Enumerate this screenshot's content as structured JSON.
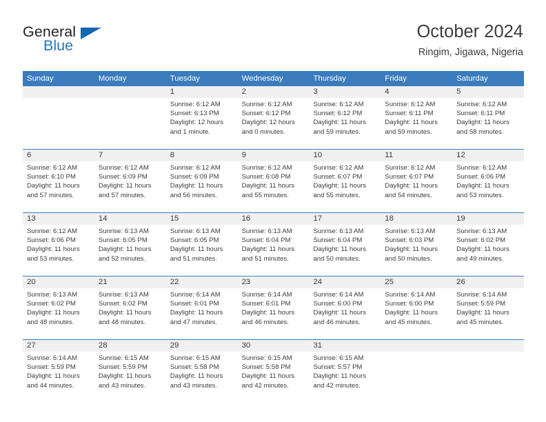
{
  "brand": {
    "line1": "General",
    "line2": "Blue",
    "triangle_icon": "brand-triangle-icon",
    "accent_color": "#1f77c4"
  },
  "header": {
    "title": "October 2024",
    "location": "Ringim, Jigawa, Nigeria"
  },
  "theme": {
    "header_blue": "#3a7cbd",
    "number_band_gray": "#f0f0f0",
    "text_color": "#3a3a3a"
  },
  "day_names": [
    "Sunday",
    "Monday",
    "Tuesday",
    "Wednesday",
    "Thursday",
    "Friday",
    "Saturday"
  ],
  "labels": {
    "sunrise_prefix": "Sunrise:",
    "sunset_prefix": "Sunset:",
    "daylight_prefix": "Daylight:"
  },
  "weeks": [
    [
      {
        "day": "",
        "empty": true
      },
      {
        "day": "",
        "empty": true
      },
      {
        "day": "1",
        "sunrise": "Sunrise: 6:12 AM",
        "sunset": "Sunset: 6:13 PM",
        "daylight_1": "Daylight: 12 hours",
        "daylight_2": "and 1 minute."
      },
      {
        "day": "2",
        "sunrise": "Sunrise: 6:12 AM",
        "sunset": "Sunset: 6:12 PM",
        "daylight_1": "Daylight: 12 hours",
        "daylight_2": "and 0 minutes."
      },
      {
        "day": "3",
        "sunrise": "Sunrise: 6:12 AM",
        "sunset": "Sunset: 6:12 PM",
        "daylight_1": "Daylight: 11 hours",
        "daylight_2": "and 59 minutes."
      },
      {
        "day": "4",
        "sunrise": "Sunrise: 6:12 AM",
        "sunset": "Sunset: 6:11 PM",
        "daylight_1": "Daylight: 11 hours",
        "daylight_2": "and 59 minutes."
      },
      {
        "day": "5",
        "sunrise": "Sunrise: 6:12 AM",
        "sunset": "Sunset: 6:11 PM",
        "daylight_1": "Daylight: 11 hours",
        "daylight_2": "and 58 minutes."
      }
    ],
    [
      {
        "day": "6",
        "sunrise": "Sunrise: 6:12 AM",
        "sunset": "Sunset: 6:10 PM",
        "daylight_1": "Daylight: 11 hours",
        "daylight_2": "and 57 minutes."
      },
      {
        "day": "7",
        "sunrise": "Sunrise: 6:12 AM",
        "sunset": "Sunset: 6:09 PM",
        "daylight_1": "Daylight: 11 hours",
        "daylight_2": "and 57 minutes."
      },
      {
        "day": "8",
        "sunrise": "Sunrise: 6:12 AM",
        "sunset": "Sunset: 6:09 PM",
        "daylight_1": "Daylight: 11 hours",
        "daylight_2": "and 56 minutes."
      },
      {
        "day": "9",
        "sunrise": "Sunrise: 6:12 AM",
        "sunset": "Sunset: 6:08 PM",
        "daylight_1": "Daylight: 11 hours",
        "daylight_2": "and 55 minutes."
      },
      {
        "day": "10",
        "sunrise": "Sunrise: 6:12 AM",
        "sunset": "Sunset: 6:07 PM",
        "daylight_1": "Daylight: 11 hours",
        "daylight_2": "and 55 minutes."
      },
      {
        "day": "11",
        "sunrise": "Sunrise: 6:12 AM",
        "sunset": "Sunset: 6:07 PM",
        "daylight_1": "Daylight: 11 hours",
        "daylight_2": "and 54 minutes."
      },
      {
        "day": "12",
        "sunrise": "Sunrise: 6:12 AM",
        "sunset": "Sunset: 6:06 PM",
        "daylight_1": "Daylight: 11 hours",
        "daylight_2": "and 53 minutes."
      }
    ],
    [
      {
        "day": "13",
        "sunrise": "Sunrise: 6:12 AM",
        "sunset": "Sunset: 6:06 PM",
        "daylight_1": "Daylight: 11 hours",
        "daylight_2": "and 53 minutes."
      },
      {
        "day": "14",
        "sunrise": "Sunrise: 6:13 AM",
        "sunset": "Sunset: 6:05 PM",
        "daylight_1": "Daylight: 11 hours",
        "daylight_2": "and 52 minutes."
      },
      {
        "day": "15",
        "sunrise": "Sunrise: 6:13 AM",
        "sunset": "Sunset: 6:05 PM",
        "daylight_1": "Daylight: 11 hours",
        "daylight_2": "and 51 minutes."
      },
      {
        "day": "16",
        "sunrise": "Sunrise: 6:13 AM",
        "sunset": "Sunset: 6:04 PM",
        "daylight_1": "Daylight: 11 hours",
        "daylight_2": "and 51 minutes."
      },
      {
        "day": "17",
        "sunrise": "Sunrise: 6:13 AM",
        "sunset": "Sunset: 6:04 PM",
        "daylight_1": "Daylight: 11 hours",
        "daylight_2": "and 50 minutes."
      },
      {
        "day": "18",
        "sunrise": "Sunrise: 6:13 AM",
        "sunset": "Sunset: 6:03 PM",
        "daylight_1": "Daylight: 11 hours",
        "daylight_2": "and 50 minutes."
      },
      {
        "day": "19",
        "sunrise": "Sunrise: 6:13 AM",
        "sunset": "Sunset: 6:02 PM",
        "daylight_1": "Daylight: 11 hours",
        "daylight_2": "and 49 minutes."
      }
    ],
    [
      {
        "day": "20",
        "sunrise": "Sunrise: 6:13 AM",
        "sunset": "Sunset: 6:02 PM",
        "daylight_1": "Daylight: 11 hours",
        "daylight_2": "and 48 minutes."
      },
      {
        "day": "21",
        "sunrise": "Sunrise: 6:13 AM",
        "sunset": "Sunset: 6:02 PM",
        "daylight_1": "Daylight: 11 hours",
        "daylight_2": "and 48 minutes."
      },
      {
        "day": "22",
        "sunrise": "Sunrise: 6:14 AM",
        "sunset": "Sunset: 6:01 PM",
        "daylight_1": "Daylight: 11 hours",
        "daylight_2": "and 47 minutes."
      },
      {
        "day": "23",
        "sunrise": "Sunrise: 6:14 AM",
        "sunset": "Sunset: 6:01 PM",
        "daylight_1": "Daylight: 11 hours",
        "daylight_2": "and 46 minutes."
      },
      {
        "day": "24",
        "sunrise": "Sunrise: 6:14 AM",
        "sunset": "Sunset: 6:00 PM",
        "daylight_1": "Daylight: 11 hours",
        "daylight_2": "and 46 minutes."
      },
      {
        "day": "25",
        "sunrise": "Sunrise: 6:14 AM",
        "sunset": "Sunset: 6:00 PM",
        "daylight_1": "Daylight: 11 hours",
        "daylight_2": "and 45 minutes."
      },
      {
        "day": "26",
        "sunrise": "Sunrise: 6:14 AM",
        "sunset": "Sunset: 5:59 PM",
        "daylight_1": "Daylight: 11 hours",
        "daylight_2": "and 45 minutes."
      }
    ],
    [
      {
        "day": "27",
        "sunrise": "Sunrise: 6:14 AM",
        "sunset": "Sunset: 5:59 PM",
        "daylight_1": "Daylight: 11 hours",
        "daylight_2": "and 44 minutes."
      },
      {
        "day": "28",
        "sunrise": "Sunrise: 6:15 AM",
        "sunset": "Sunset: 5:59 PM",
        "daylight_1": "Daylight: 11 hours",
        "daylight_2": "and 43 minutes."
      },
      {
        "day": "29",
        "sunrise": "Sunrise: 6:15 AM",
        "sunset": "Sunset: 5:58 PM",
        "daylight_1": "Daylight: 11 hours",
        "daylight_2": "and 43 minutes."
      },
      {
        "day": "30",
        "sunrise": "Sunrise: 6:15 AM",
        "sunset": "Sunset: 5:58 PM",
        "daylight_1": "Daylight: 11 hours",
        "daylight_2": "and 42 minutes."
      },
      {
        "day": "31",
        "sunrise": "Sunrise: 6:15 AM",
        "sunset": "Sunset: 5:57 PM",
        "daylight_1": "Daylight: 11 hours",
        "daylight_2": "and 42 minutes."
      },
      {
        "day": "",
        "empty": true
      },
      {
        "day": "",
        "empty": true
      }
    ]
  ]
}
